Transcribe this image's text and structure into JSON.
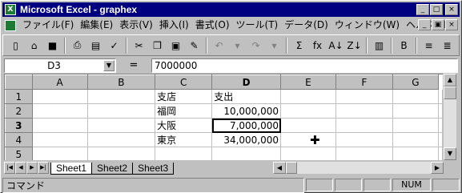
{
  "window": {
    "title": "Microsoft Excel - graphex",
    "app_icon_glyph": "X",
    "title_buttons": [
      "_",
      "□",
      "×"
    ],
    "doc_buttons": [
      "_",
      "▣",
      "×"
    ]
  },
  "menu": {
    "items": [
      "ファイル(F)",
      "編集(E)",
      "表示(V)",
      "挿入(I)",
      "書式(O)",
      "ツール(T)",
      "データ(D)",
      "ウィンドウ(W)",
      "ヘルプ(H)"
    ]
  },
  "toolbar": {
    "icons": [
      {
        "name": "new-icon",
        "glyph": "▯"
      },
      {
        "name": "open-icon",
        "glyph": "⌂"
      },
      {
        "name": "save-icon",
        "glyph": "■"
      },
      {
        "name": "sep"
      },
      {
        "name": "print-icon",
        "glyph": "⎙"
      },
      {
        "name": "print-preview-icon",
        "glyph": "▤"
      },
      {
        "name": "spelling-icon",
        "glyph": "✓"
      },
      {
        "name": "sep"
      },
      {
        "name": "cut-icon",
        "glyph": "✂"
      },
      {
        "name": "copy-icon",
        "glyph": "❐"
      },
      {
        "name": "paste-icon",
        "glyph": "▣"
      },
      {
        "name": "format-painter-icon",
        "glyph": "✎"
      },
      {
        "name": "sep"
      },
      {
        "name": "undo-icon",
        "glyph": "↶",
        "dim": true
      },
      {
        "name": "undo-dropdown-icon",
        "glyph": "▾",
        "dim": true
      },
      {
        "name": "redo-icon",
        "glyph": "↷",
        "dim": true
      },
      {
        "name": "redo-dropdown-icon",
        "glyph": "▾",
        "dim": true
      },
      {
        "name": "sep"
      },
      {
        "name": "autosum-icon",
        "glyph": "Σ"
      },
      {
        "name": "function-icon",
        "glyph": "fx"
      },
      {
        "name": "sort-ascending-icon",
        "glyph": "A↓"
      },
      {
        "name": "sort-descending-icon",
        "glyph": "Z↓"
      },
      {
        "name": "sep"
      },
      {
        "name": "chart-wizard-icon",
        "glyph": "▥"
      },
      {
        "name": "sep"
      },
      {
        "name": "bold-icon",
        "glyph": "B"
      },
      {
        "name": "sep"
      },
      {
        "name": "align-left-icon",
        "glyph": "≡"
      },
      {
        "name": "align-center-icon",
        "glyph": "≣"
      }
    ]
  },
  "formula_bar": {
    "cell_ref": "D3",
    "equals_glyph": "=",
    "value": "7000000"
  },
  "grid": {
    "columns": [
      "A",
      "B",
      "C",
      "D",
      "E",
      "F",
      "G"
    ],
    "active_column": "D",
    "active_row": "3",
    "rows": [
      {
        "num": "1",
        "cells": [
          "",
          "",
          "支店",
          "支出",
          "",
          "",
          ""
        ]
      },
      {
        "num": "2",
        "cells": [
          "",
          "",
          "福岡",
          "10,000,000",
          "",
          "",
          ""
        ]
      },
      {
        "num": "3",
        "cells": [
          "",
          "",
          "大阪",
          "7,000,000",
          "",
          "",
          ""
        ]
      },
      {
        "num": "4",
        "cells": [
          "",
          "",
          "東京",
          "34,000,000",
          "",
          "",
          ""
        ]
      },
      {
        "num": "5",
        "cells": [
          "",
          "",
          "",
          "",
          "",
          "",
          ""
        ]
      }
    ],
    "cursor_glyph": "✚"
  },
  "sheets": {
    "nav_glyphs": [
      "|◀",
      "◀",
      "▶",
      "▶|"
    ],
    "tabs": [
      "Sheet1",
      "Sheet2",
      "Sheet3"
    ],
    "active": "Sheet1"
  },
  "status": {
    "text": "コマンド",
    "num_indicator": "NUM"
  }
}
